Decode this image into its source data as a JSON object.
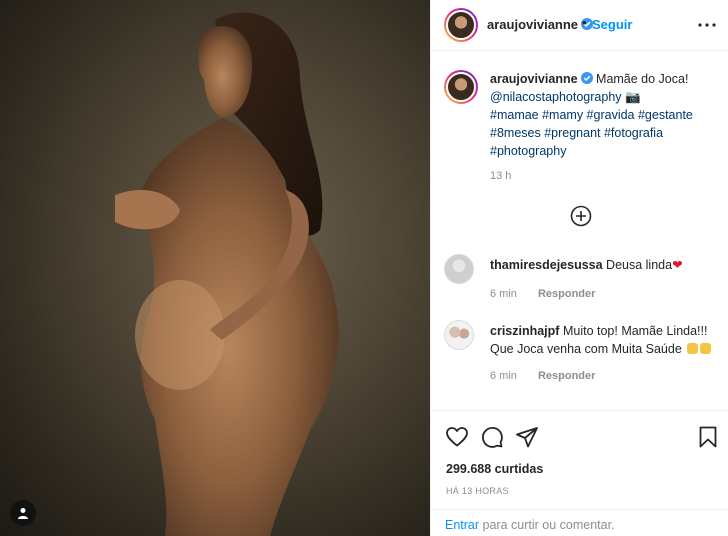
{
  "post": {
    "username": "araujovivianne",
    "follow_label": "Seguir",
    "separator": "•"
  },
  "caption": {
    "username": "araujovivianne",
    "text": "Mamãe do Joca!",
    "mention": "@nilacostaphotography",
    "emoji": "📷",
    "hashtags_line1": "#mamae #mamy #gravida #gestante",
    "hashtags_line2": "#8meses #pregnant #fotografia",
    "hashtags_line3": "#photography",
    "time": "13 h"
  },
  "comments": [
    {
      "username": "thamiresdejesussa",
      "text": "Deusa linda",
      "emoji": "❤",
      "time": "6 min",
      "reply_label": "Responder"
    },
    {
      "username": "criszinhajpf",
      "text_line1": "Muito top! Mamãe Linda!!!",
      "text_line2": "Que Joca venha com Muita Saúde",
      "time": "6 min",
      "reply_label": "Responder"
    }
  ],
  "footer": {
    "likes": "299.688 curtidas",
    "posted_ago": "HÁ 13 HORAS",
    "login_link": "Entrar",
    "login_text": " para curtir ou comentar."
  },
  "icons": {
    "more": "more-options-icon",
    "add": "plus-circle-icon",
    "like": "heart-icon",
    "comment": "comment-icon",
    "share": "share-icon",
    "save": "bookmark-icon",
    "verified": "verified-badge-icon",
    "user_tag": "user-tag-icon"
  },
  "colors": {
    "accent": "#0095f6",
    "hashtag": "#00376b",
    "muted": "#8e8e8e",
    "text": "#262626"
  }
}
